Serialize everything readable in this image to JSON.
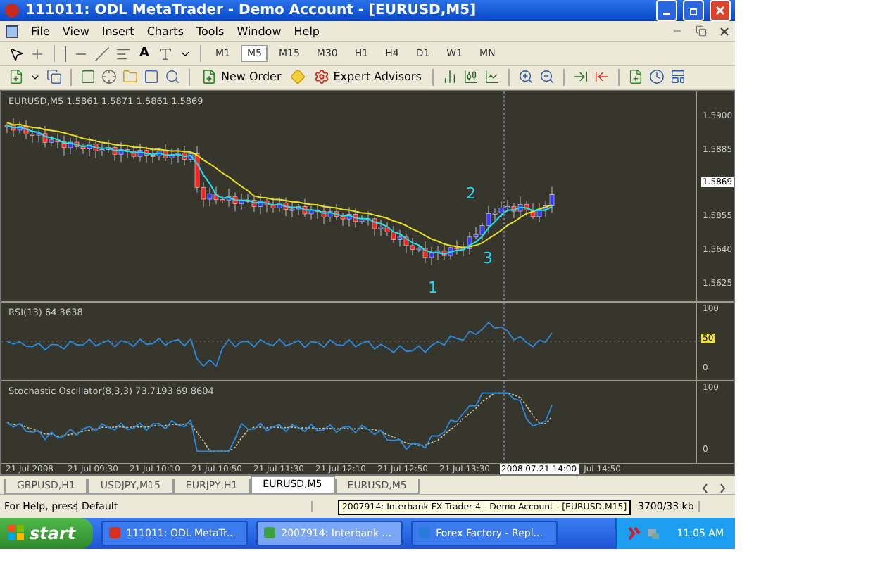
{
  "window": {
    "title": "111011: ODL MetaTrader - Demo Account - [EURUSD,M5]"
  },
  "menu": [
    "File",
    "View",
    "Insert",
    "Charts",
    "Tools",
    "Window",
    "Help"
  ],
  "drawing_toolbar": {
    "text_tool": "A",
    "timeframes": [
      {
        "label": "M1",
        "selected": false
      },
      {
        "label": "M5",
        "selected": true
      },
      {
        "label": "M15",
        "selected": false
      },
      {
        "label": "M30",
        "selected": false
      },
      {
        "label": "H1",
        "selected": false
      },
      {
        "label": "H4",
        "selected": false
      },
      {
        "label": "D1",
        "selected": false
      },
      {
        "label": "W1",
        "selected": false
      },
      {
        "label": "MN",
        "selected": false
      }
    ]
  },
  "standard_toolbar": {
    "new_order": "New Order",
    "expert_advisors": "Expert Advisors"
  },
  "chart": {
    "header": "EURUSD,M5  1.5861 1.5871 1.5861 1.5869",
    "wave_labels": [
      "1",
      "2",
      "3"
    ],
    "price_axis": [
      {
        "label": "1.5900",
        "highlighted": false
      },
      {
        "label": "1.5885",
        "highlighted": false
      },
      {
        "label": "1.5869",
        "highlighted": true
      },
      {
        "label": "1.5855",
        "highlighted": false
      },
      {
        "label": "1.5640",
        "highlighted": false
      },
      {
        "label": "1.5625",
        "highlighted": false
      }
    ],
    "rsi": {
      "label": "RSI(13) 64.3638",
      "axis": [
        {
          "label": "100",
          "highlighted": false
        },
        {
          "label": "50",
          "highlighted": true
        },
        {
          "label": "0",
          "highlighted": false
        }
      ]
    },
    "stochastic": {
      "label": "Stochastic Oscillator(8,3,3) 73.7193 69.8604",
      "axis": [
        "100",
        "0"
      ]
    },
    "time_axis": [
      {
        "label": "21 Jul 2008",
        "highlighted": false
      },
      {
        "label": "21 Jul 09:30",
        "highlighted": false
      },
      {
        "label": "21 Jul 10:10",
        "highlighted": false
      },
      {
        "label": "21 Jul 10:50",
        "highlighted": false
      },
      {
        "label": "21 Jul 11:30",
        "highlighted": false
      },
      {
        "label": "21 Jul 12:10",
        "highlighted": false
      },
      {
        "label": "21 Jul 12:50",
        "highlighted": false
      },
      {
        "label": "21 Jul 13:30",
        "highlighted": false
      },
      {
        "label": "2008.07.21 14:00",
        "highlighted": true
      },
      {
        "label": "Jul 14:50",
        "highlighted": false
      }
    ]
  },
  "tabs": [
    {
      "label": "GBPUSD,H1",
      "selected": false
    },
    {
      "label": "USDJPY,M15",
      "selected": false
    },
    {
      "label": "EURJPY,H1",
      "selected": false
    },
    {
      "label": "EURUSD,M5",
      "selected": true
    },
    {
      "label": "EURUSD,M5",
      "selected": false
    }
  ],
  "status_bar": {
    "help": "For Help, press",
    "profile": "Default",
    "traffic": "3700/33 kb"
  },
  "tooltip": "2007914: Interbank FX Trader 4 - Demo Account - [EURUSD,M15]",
  "taskbar": {
    "start": "start",
    "tasks": [
      {
        "label": "111011: ODL MetaTr...",
        "selected": false
      },
      {
        "label": "2007914: Interbank ...",
        "selected": true
      },
      {
        "label": "Forex Factory - Repl...",
        "selected": false
      }
    ],
    "clock": "11:05 AM"
  }
}
